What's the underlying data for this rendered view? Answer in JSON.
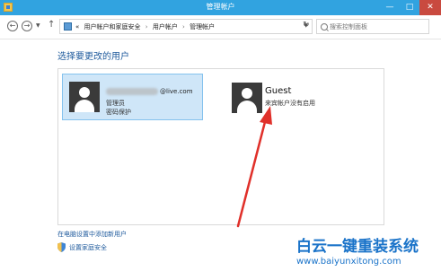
{
  "window": {
    "title": "管理帐户"
  },
  "titlebar_buttons": {
    "minimize": "—",
    "maximize": "□",
    "close": "✕"
  },
  "nav": {
    "back_glyph": "←",
    "forward_glyph": "→",
    "up_glyph": "↑",
    "prefix": "«",
    "breadcrumbs": [
      "用户帐户和家庭安全",
      "用户帐户",
      "管理帐户"
    ],
    "separator": "›",
    "refresh_glyph": "↻"
  },
  "search": {
    "placeholder": "搜索控制面板"
  },
  "main": {
    "heading": "选择要更改的用户",
    "accounts": [
      {
        "email_suffix": "@live.com",
        "role": "管理员",
        "status": "密码保护"
      },
      {
        "name": "Guest",
        "status": "来宾帐户没有启用"
      }
    ],
    "add_user_link": "在电脑设置中添加新用户",
    "family_safety_link": "设置家庭安全"
  },
  "watermark": {
    "text": "白云一键重装系统",
    "url": "www.baiyunxitong.com"
  },
  "colors": {
    "titlebar": "#31a3e0",
    "selected_tile": "#cfe6f8",
    "link": "#1e5a9c",
    "arrow": "#e0302a",
    "watermark": "#1a73c9"
  }
}
